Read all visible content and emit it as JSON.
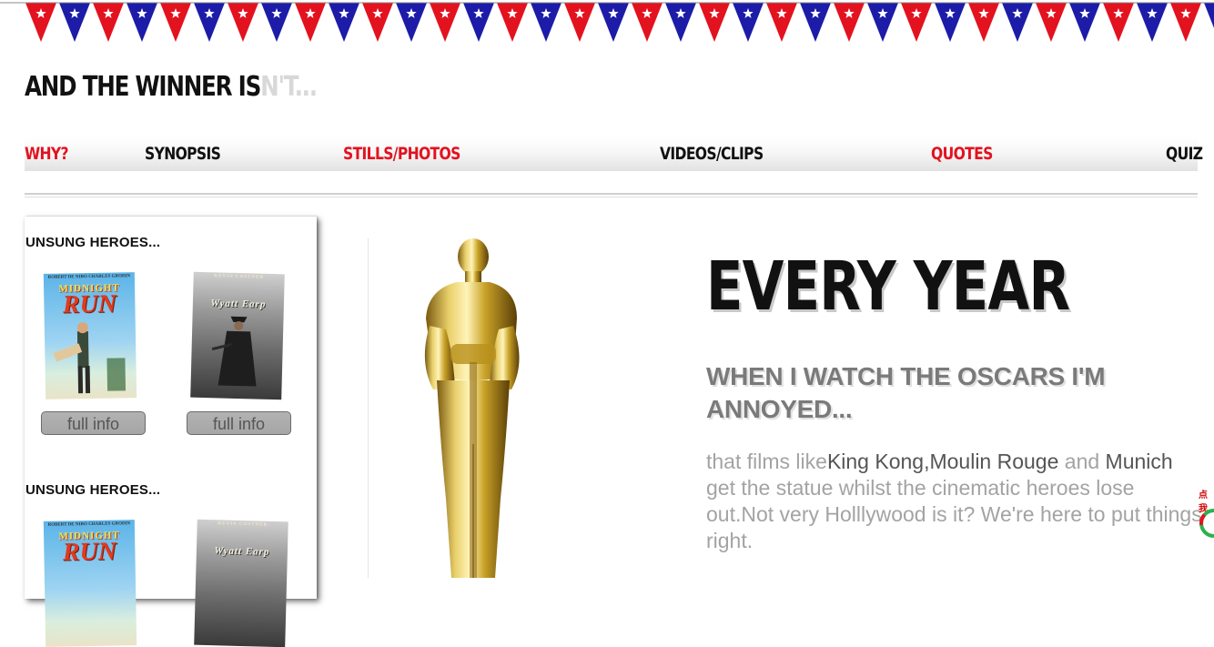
{
  "site": {
    "title_main": "AND THE WINNER IS",
    "title_faded": "N'T..."
  },
  "nav": {
    "items": [
      {
        "label": "WHY?"
      },
      {
        "label": "SYNOPSIS"
      },
      {
        "label": "STILLS/PHOTOS"
      },
      {
        "label": "VIDEOS/CLIPS"
      },
      {
        "label": "QUOTES"
      },
      {
        "label": "QUIZ"
      }
    ]
  },
  "sidebar": {
    "sections": [
      {
        "heading": "UNSUNG HEROES...",
        "movies": [
          {
            "poster_credits": "ROBERT DE NIRO   CHARLES GRODIN",
            "poster_title_top": "MIDNIGHT",
            "poster_title_bottom": "RUN",
            "button": "full info"
          },
          {
            "poster_credits": "KEVIN COSTNER",
            "poster_title_top": "Wyatt Earp",
            "button": "full info"
          }
        ]
      },
      {
        "heading": "UNSUNG HEROES...",
        "movies": [
          {
            "poster_credits": "ROBERT DE NIRO   CHARLES GRODIN",
            "poster_title_top": "MIDNIGHT",
            "poster_title_bottom": "RUN"
          },
          {
            "poster_credits": "KEVIN COSTNER",
            "poster_title_top": "Wyatt Earp"
          }
        ]
      }
    ]
  },
  "hero": {
    "title": "EVERY YEAR",
    "subtitle": "WHEN I WATCH THE OSCARS I'M ANNOYED...",
    "body": {
      "p1": "that films like",
      "film1": "King Kong",
      "sep1": ",",
      "film2": "Moulin Rouge",
      "p2": " and ",
      "film3": "Munich",
      "p3": " get the statue whilst the cinematic heroes lose out.Not very Holllywood is it? We're here to put things right."
    }
  },
  "corner_widget": {
    "label": "点我"
  },
  "colors": {
    "bunting_red": "#e3121f",
    "bunting_blue": "#1c1ca8",
    "nav_red": "#e3121f",
    "text_dark": "#111111",
    "oscar_gold": "#c9a227"
  },
  "icons": {
    "bunting": "flag-bunting",
    "statue": "oscar-statue-image"
  }
}
